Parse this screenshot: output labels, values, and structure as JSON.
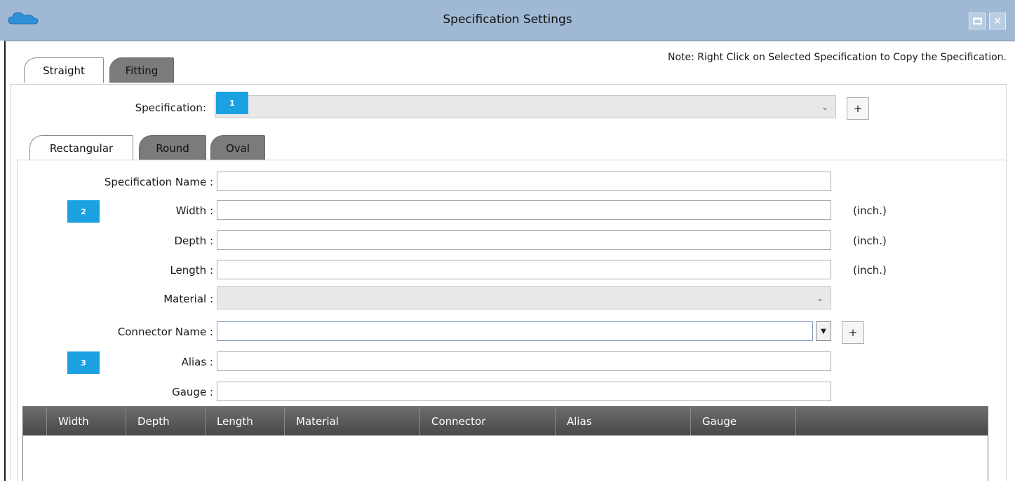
{
  "window": {
    "title": "Specification Settings"
  },
  "note": "Note: Right Click on Selected Specification to Copy the Specification.",
  "top_tabs": [
    {
      "label": "Straight",
      "active": true
    },
    {
      "label": "Fitting",
      "active": false
    }
  ],
  "specification": {
    "label": "Specification:",
    "value": "",
    "add_label": "+"
  },
  "shape_tabs": [
    {
      "label": "Rectangular",
      "active": true
    },
    {
      "label": "Round",
      "active": false
    },
    {
      "label": "Oval",
      "active": false
    }
  ],
  "form": {
    "spec_name_label": "Specification Name :",
    "width_label": "Width :",
    "depth_label": "Depth :",
    "length_label": "Length :",
    "material_label": "Material :",
    "connector_label": "Connector Name :",
    "alias_label": "Alias :",
    "gauge_label": "Gauge :",
    "unit": "(inch.)",
    "connector_add_label": "+"
  },
  "markers": [
    "1",
    "2",
    "3"
  ],
  "table": {
    "columns": [
      "Width",
      "Depth",
      "Length",
      "Material",
      "Connector",
      "Alias",
      "Gauge"
    ],
    "rows": []
  },
  "colors": {
    "titlebar": "#9fb8d3",
    "marker": "#1ba1e2",
    "grid_header": "#555555"
  }
}
